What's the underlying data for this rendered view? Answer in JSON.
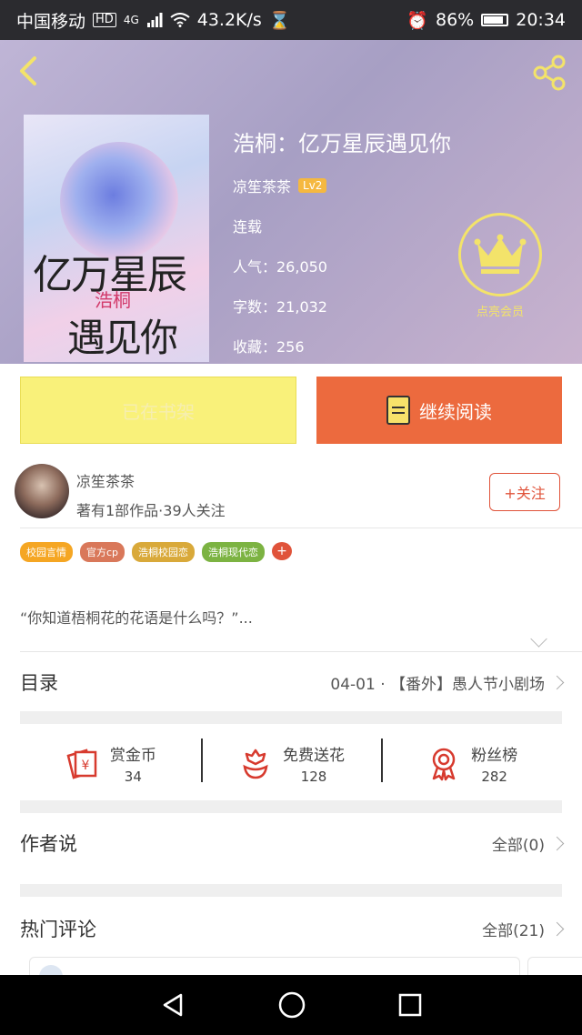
{
  "status_bar": {
    "carrier": "中国移动",
    "hd": "HD",
    "network": "4G",
    "speed": "43.2K/s",
    "battery": "86%",
    "battery_level": 0.86,
    "time": "20:34"
  },
  "book": {
    "cover_title_line1": "亿万星辰",
    "cover_title_pair": "浩桐",
    "cover_title_line2": "遇见你",
    "title": "浩桐：亿万星辰遇见你",
    "author": "凉笙茶茶",
    "author_level": "Lv2",
    "status": "连载",
    "popularity": "人气：26,050",
    "word_count": "字数：21,032",
    "favorites": "收藏：256",
    "vip_label": "点亮会员"
  },
  "actions": {
    "shelf_label": "已在书架",
    "read_label": "继续阅读"
  },
  "author_card": {
    "name": "凉笙茶茶",
    "summary": "著有1部作品·39人关注",
    "follow_label": "+关注"
  },
  "tags": [
    {
      "label": "校园言情",
      "color": "#f5a623"
    },
    {
      "label": "官方cp",
      "color": "#d9785a"
    },
    {
      "label": "浩桐校园恋",
      "color": "#d9a93a"
    },
    {
      "label": "浩桐现代恋",
      "color": "#7cb342"
    }
  ],
  "tag_more": "+",
  "intro": "“你知道梧桐花的花语是什么吗？”...",
  "catalog": {
    "title": "目录",
    "latest": "04-01 · 【番外】愚人节小剧场"
  },
  "stats": [
    {
      "label": "赏金币",
      "value": "34",
      "icon": "reward-coin-icon"
    },
    {
      "label": "免费送花",
      "value": "128",
      "icon": "flower-icon"
    },
    {
      "label": "粉丝榜",
      "value": "282",
      "icon": "medal-icon"
    }
  ],
  "author_says": {
    "title": "作者说",
    "all": "全部(0)"
  },
  "hot_comments": {
    "title": "热门评论",
    "all": "全部(21)"
  },
  "colors": {
    "accent": "#ec6a3e",
    "shelf": "#f9f17a",
    "crown": "#f3e36a"
  }
}
